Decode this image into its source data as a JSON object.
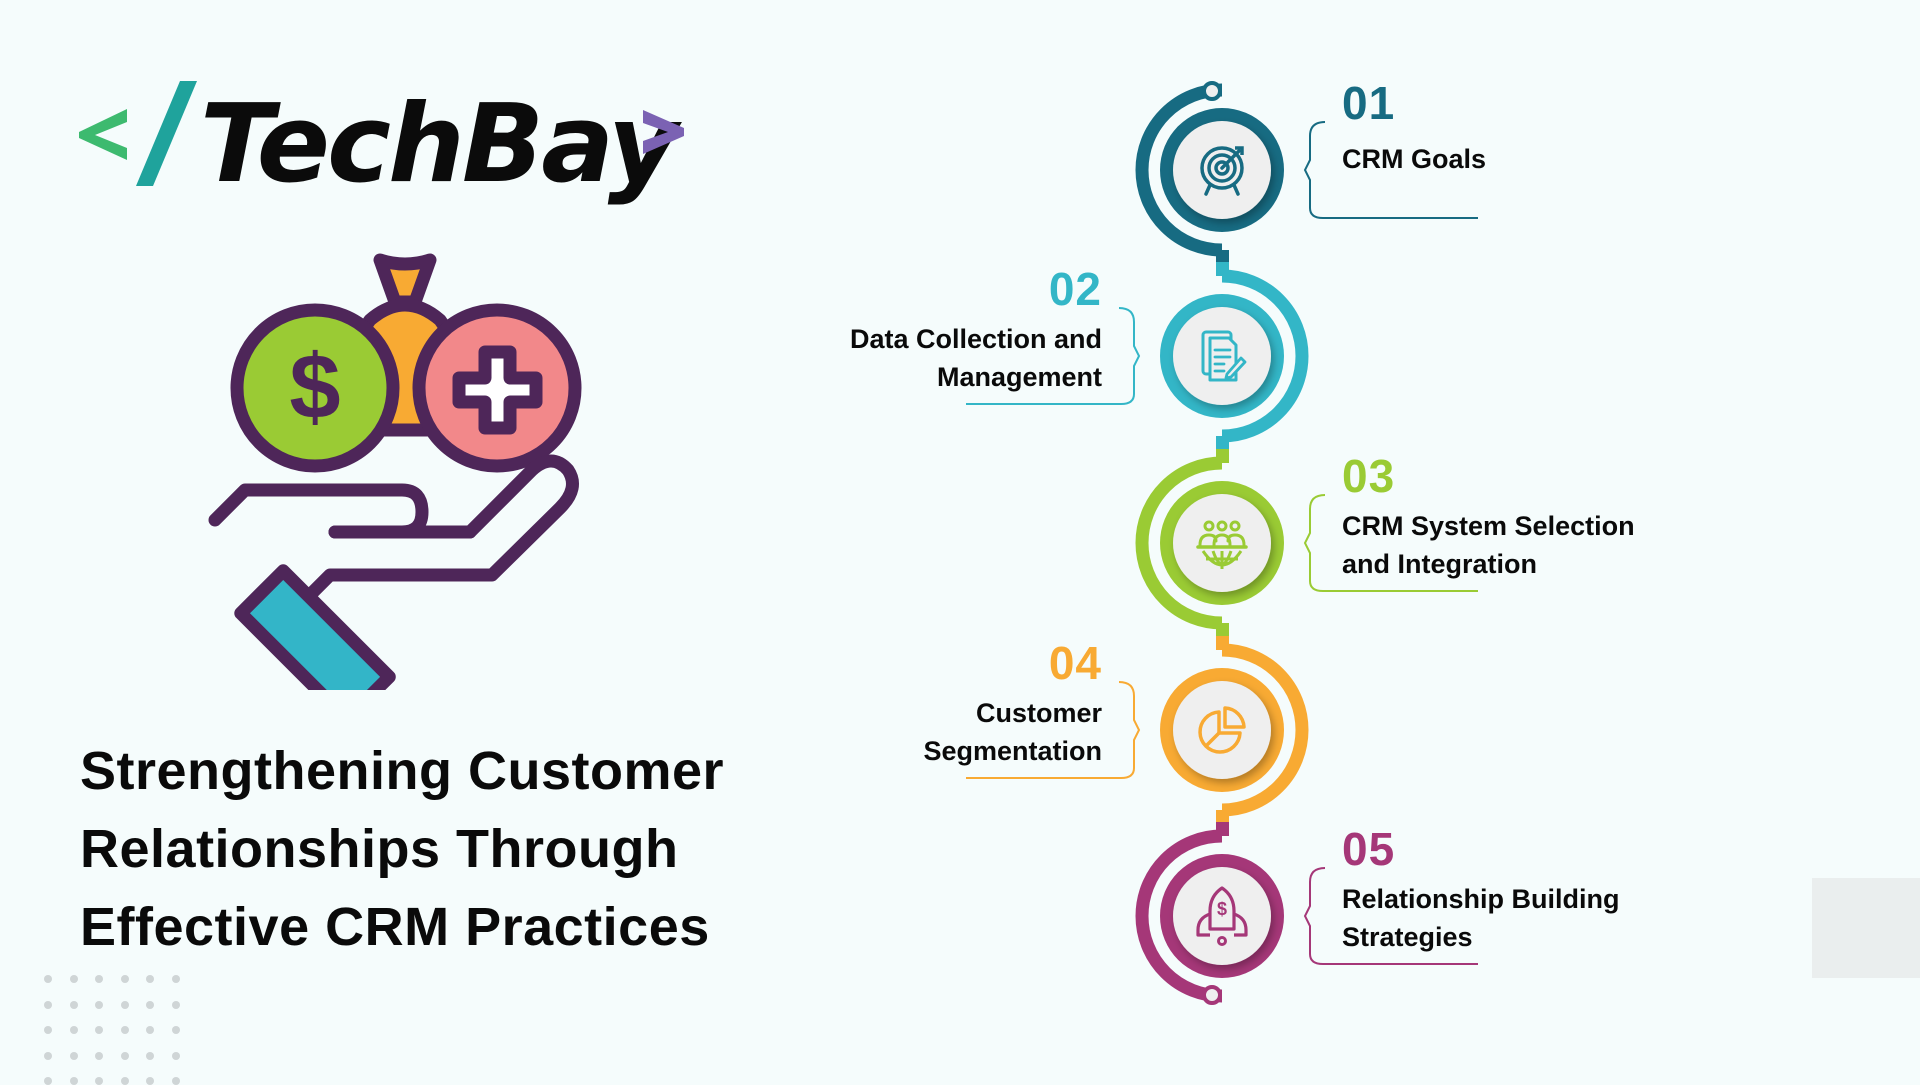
{
  "brand": {
    "logo_prefix": "</",
    "logo_name": "TechBay",
    "logo_suffix": ">",
    "colors": {
      "bracket_left": "#3dba6f",
      "slash": "#1fa39c",
      "bracket_right": "#7b62b3",
      "text": "#0b0b0b"
    }
  },
  "illustration": {
    "name": "hand-holding-money-and-health-coins",
    "colors": {
      "outline": "#4e2659",
      "dollar_coin": "#9acb34",
      "money_bag": "#f8aa33",
      "health_coin": "#f2888a",
      "cuff": "#33b5c8"
    }
  },
  "title": {
    "lines": [
      "Strengthening Customer",
      "Relationships Through",
      "Effective CRM Practices"
    ]
  },
  "steps": [
    {
      "number": "01",
      "label_lines": [
        "CRM Goals"
      ],
      "icon": "target-icon",
      "color": "#176b82",
      "side": "right"
    },
    {
      "number": "02",
      "label_lines": [
        "Data Collection and",
        "Management"
      ],
      "icon": "document-edit-icon",
      "color": "#33b6c7",
      "side": "left"
    },
    {
      "number": "03",
      "label_lines": [
        "CRM System Selection",
        "and Integration"
      ],
      "icon": "team-globe-icon",
      "color": "#9acb34",
      "side": "right"
    },
    {
      "number": "04",
      "label_lines": [
        "Customer",
        "Segmentation"
      ],
      "icon": "pie-chart-icon",
      "color": "#f8aa33",
      "side": "left"
    },
    {
      "number": "05",
      "label_lines": [
        "Relationship Building",
        "Strategies"
      ],
      "icon": "rocket-dollar-icon",
      "color": "#a53778",
      "side": "right"
    }
  ],
  "theme": {
    "background": "#f5fcfc",
    "icon_disc": "#efefef",
    "dot_grid": "#cfd5d6",
    "gray_box": "#eaeeee"
  }
}
